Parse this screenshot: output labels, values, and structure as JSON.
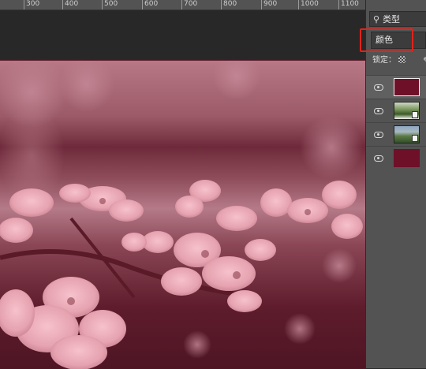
{
  "ruler": {
    "labels": [
      "300",
      "400",
      "500",
      "600",
      "700",
      "800",
      "900",
      "1000",
      "1100"
    ]
  },
  "layers_panel": {
    "search_label": "类型",
    "blend_mode": "颜色",
    "lock_label": "锁定：",
    "layers": [
      {
        "type": "color-fill",
        "color": "#6e1028",
        "visible": true,
        "selected": true
      },
      {
        "type": "smart-object-photo",
        "visible": true,
        "selected": false
      },
      {
        "type": "smart-object-photo",
        "visible": true,
        "selected": false
      },
      {
        "type": "color-fill",
        "color": "#6e1028",
        "visible": true,
        "selected": false
      }
    ]
  },
  "annotation": {
    "highlight_color": "#e0241c"
  },
  "image": {
    "description_color": "#9c5a68"
  },
  "icons": [
    "search-icon",
    "checker-lock-icon",
    "brush-lock-icon",
    "eye-icon",
    "smart-object-icon"
  ]
}
